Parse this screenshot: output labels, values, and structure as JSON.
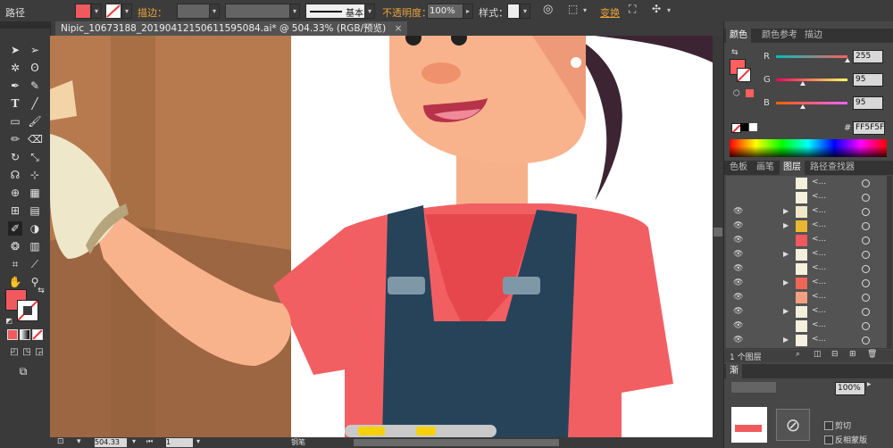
{
  "control_bar": {
    "selection_label": "路径",
    "stroke_label": "描边：",
    "brush_label": "基本",
    "opacity_label": "不透明度：",
    "opacity_value": "100%",
    "style_label": "样式：",
    "transform_label": "变换",
    "fill_color": "#f05a5e"
  },
  "document_tab": {
    "title": "Nipic_10673188_20190412150611595084.ai* @ 504.33% (RGB/预览)",
    "close": "×"
  },
  "color_panel": {
    "tabs": [
      "颜色",
      "颜色参考",
      "描边"
    ],
    "channels": [
      {
        "label": "R",
        "value": "255",
        "fraction": 1.0
      },
      {
        "label": "G",
        "value": "95",
        "fraction": 0.37
      },
      {
        "label": "B",
        "value": "95",
        "fraction": 0.37
      }
    ],
    "hex_prefix": "#",
    "hex_value": "FF5F5F",
    "current_color": "#ff5f5f"
  },
  "layers_panel": {
    "tabs": [
      "色板",
      "画笔",
      "图层",
      "路径查找器"
    ],
    "rows": [
      {
        "name": "<...",
        "thumb": "#f4f0dc",
        "eye": false,
        "expand": false
      },
      {
        "name": "<...",
        "thumb": "#f4f0dc",
        "eye": false,
        "expand": false
      },
      {
        "name": "<...",
        "thumb": "#f0e8c8",
        "eye": true,
        "expand": true
      },
      {
        "name": "<...",
        "thumb": "#e8b830",
        "eye": true,
        "expand": true
      },
      {
        "name": "<...",
        "thumb": "#f05a5e",
        "eye": true,
        "expand": false
      },
      {
        "name": "<...",
        "thumb": "#f4f0dc",
        "eye": true,
        "expand": true
      },
      {
        "name": "<...",
        "thumb": "#f4f0dc",
        "eye": true,
        "expand": false
      },
      {
        "name": "<...",
        "thumb": "#ee6655",
        "eye": true,
        "expand": true
      },
      {
        "name": "<...",
        "thumb": "#f4a080",
        "eye": true,
        "expand": false
      },
      {
        "name": "<...",
        "thumb": "#f4f0dc",
        "eye": true,
        "expand": true
      },
      {
        "name": "<...",
        "thumb": "#f4f0dc",
        "eye": true,
        "expand": false
      },
      {
        "name": "<...",
        "thumb": "#f5f0e0",
        "eye": true,
        "expand": true
      }
    ],
    "footer_count": "1 个图层"
  },
  "transparency_panel": {
    "tab_label": "渐",
    "opacity_value": "100%",
    "clip_label": "剪切",
    "invert_mask_label": "反相蒙版"
  },
  "status_bar": {
    "zoom_value": "504.33",
    "page_value": "1",
    "tool_name": "钢笔"
  },
  "icons": [
    "selection-arrow",
    "direct-selection",
    "magic-wand",
    "lasso",
    "pen",
    "curvature",
    "type",
    "line",
    "rectangle",
    "brush",
    "pencil",
    "eraser",
    "rotate",
    "scale",
    "warp",
    "free-transform",
    "shape-builder",
    "perspective",
    "mesh",
    "gradient",
    "eyedropper",
    "blend",
    "symbol-sprayer",
    "column-graph",
    "artboard",
    "slice",
    "hand",
    "zoom"
  ]
}
